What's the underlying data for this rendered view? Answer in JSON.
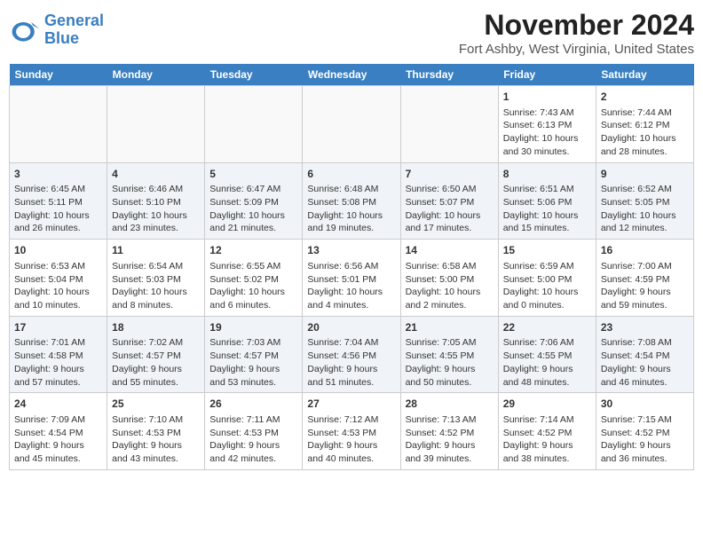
{
  "header": {
    "logo_line1": "General",
    "logo_line2": "Blue",
    "title": "November 2024",
    "subtitle": "Fort Ashby, West Virginia, United States"
  },
  "weekdays": [
    "Sunday",
    "Monday",
    "Tuesday",
    "Wednesday",
    "Thursday",
    "Friday",
    "Saturday"
  ],
  "weeks": [
    [
      {
        "day": "",
        "info": ""
      },
      {
        "day": "",
        "info": ""
      },
      {
        "day": "",
        "info": ""
      },
      {
        "day": "",
        "info": ""
      },
      {
        "day": "",
        "info": ""
      },
      {
        "day": "1",
        "info": "Sunrise: 7:43 AM\nSunset: 6:13 PM\nDaylight: 10 hours and 30 minutes."
      },
      {
        "day": "2",
        "info": "Sunrise: 7:44 AM\nSunset: 6:12 PM\nDaylight: 10 hours and 28 minutes."
      }
    ],
    [
      {
        "day": "3",
        "info": "Sunrise: 6:45 AM\nSunset: 5:11 PM\nDaylight: 10 hours and 26 minutes."
      },
      {
        "day": "4",
        "info": "Sunrise: 6:46 AM\nSunset: 5:10 PM\nDaylight: 10 hours and 23 minutes."
      },
      {
        "day": "5",
        "info": "Sunrise: 6:47 AM\nSunset: 5:09 PM\nDaylight: 10 hours and 21 minutes."
      },
      {
        "day": "6",
        "info": "Sunrise: 6:48 AM\nSunset: 5:08 PM\nDaylight: 10 hours and 19 minutes."
      },
      {
        "day": "7",
        "info": "Sunrise: 6:50 AM\nSunset: 5:07 PM\nDaylight: 10 hours and 17 minutes."
      },
      {
        "day": "8",
        "info": "Sunrise: 6:51 AM\nSunset: 5:06 PM\nDaylight: 10 hours and 15 minutes."
      },
      {
        "day": "9",
        "info": "Sunrise: 6:52 AM\nSunset: 5:05 PM\nDaylight: 10 hours and 12 minutes."
      }
    ],
    [
      {
        "day": "10",
        "info": "Sunrise: 6:53 AM\nSunset: 5:04 PM\nDaylight: 10 hours and 10 minutes."
      },
      {
        "day": "11",
        "info": "Sunrise: 6:54 AM\nSunset: 5:03 PM\nDaylight: 10 hours and 8 minutes."
      },
      {
        "day": "12",
        "info": "Sunrise: 6:55 AM\nSunset: 5:02 PM\nDaylight: 10 hours and 6 minutes."
      },
      {
        "day": "13",
        "info": "Sunrise: 6:56 AM\nSunset: 5:01 PM\nDaylight: 10 hours and 4 minutes."
      },
      {
        "day": "14",
        "info": "Sunrise: 6:58 AM\nSunset: 5:00 PM\nDaylight: 10 hours and 2 minutes."
      },
      {
        "day": "15",
        "info": "Sunrise: 6:59 AM\nSunset: 5:00 PM\nDaylight: 10 hours and 0 minutes."
      },
      {
        "day": "16",
        "info": "Sunrise: 7:00 AM\nSunset: 4:59 PM\nDaylight: 9 hours and 59 minutes."
      }
    ],
    [
      {
        "day": "17",
        "info": "Sunrise: 7:01 AM\nSunset: 4:58 PM\nDaylight: 9 hours and 57 minutes."
      },
      {
        "day": "18",
        "info": "Sunrise: 7:02 AM\nSunset: 4:57 PM\nDaylight: 9 hours and 55 minutes."
      },
      {
        "day": "19",
        "info": "Sunrise: 7:03 AM\nSunset: 4:57 PM\nDaylight: 9 hours and 53 minutes."
      },
      {
        "day": "20",
        "info": "Sunrise: 7:04 AM\nSunset: 4:56 PM\nDaylight: 9 hours and 51 minutes."
      },
      {
        "day": "21",
        "info": "Sunrise: 7:05 AM\nSunset: 4:55 PM\nDaylight: 9 hours and 50 minutes."
      },
      {
        "day": "22",
        "info": "Sunrise: 7:06 AM\nSunset: 4:55 PM\nDaylight: 9 hours and 48 minutes."
      },
      {
        "day": "23",
        "info": "Sunrise: 7:08 AM\nSunset: 4:54 PM\nDaylight: 9 hours and 46 minutes."
      }
    ],
    [
      {
        "day": "24",
        "info": "Sunrise: 7:09 AM\nSunset: 4:54 PM\nDaylight: 9 hours and 45 minutes."
      },
      {
        "day": "25",
        "info": "Sunrise: 7:10 AM\nSunset: 4:53 PM\nDaylight: 9 hours and 43 minutes."
      },
      {
        "day": "26",
        "info": "Sunrise: 7:11 AM\nSunset: 4:53 PM\nDaylight: 9 hours and 42 minutes."
      },
      {
        "day": "27",
        "info": "Sunrise: 7:12 AM\nSunset: 4:53 PM\nDaylight: 9 hours and 40 minutes."
      },
      {
        "day": "28",
        "info": "Sunrise: 7:13 AM\nSunset: 4:52 PM\nDaylight: 9 hours and 39 minutes."
      },
      {
        "day": "29",
        "info": "Sunrise: 7:14 AM\nSunset: 4:52 PM\nDaylight: 9 hours and 38 minutes."
      },
      {
        "day": "30",
        "info": "Sunrise: 7:15 AM\nSunset: 4:52 PM\nDaylight: 9 hours and 36 minutes."
      }
    ]
  ]
}
